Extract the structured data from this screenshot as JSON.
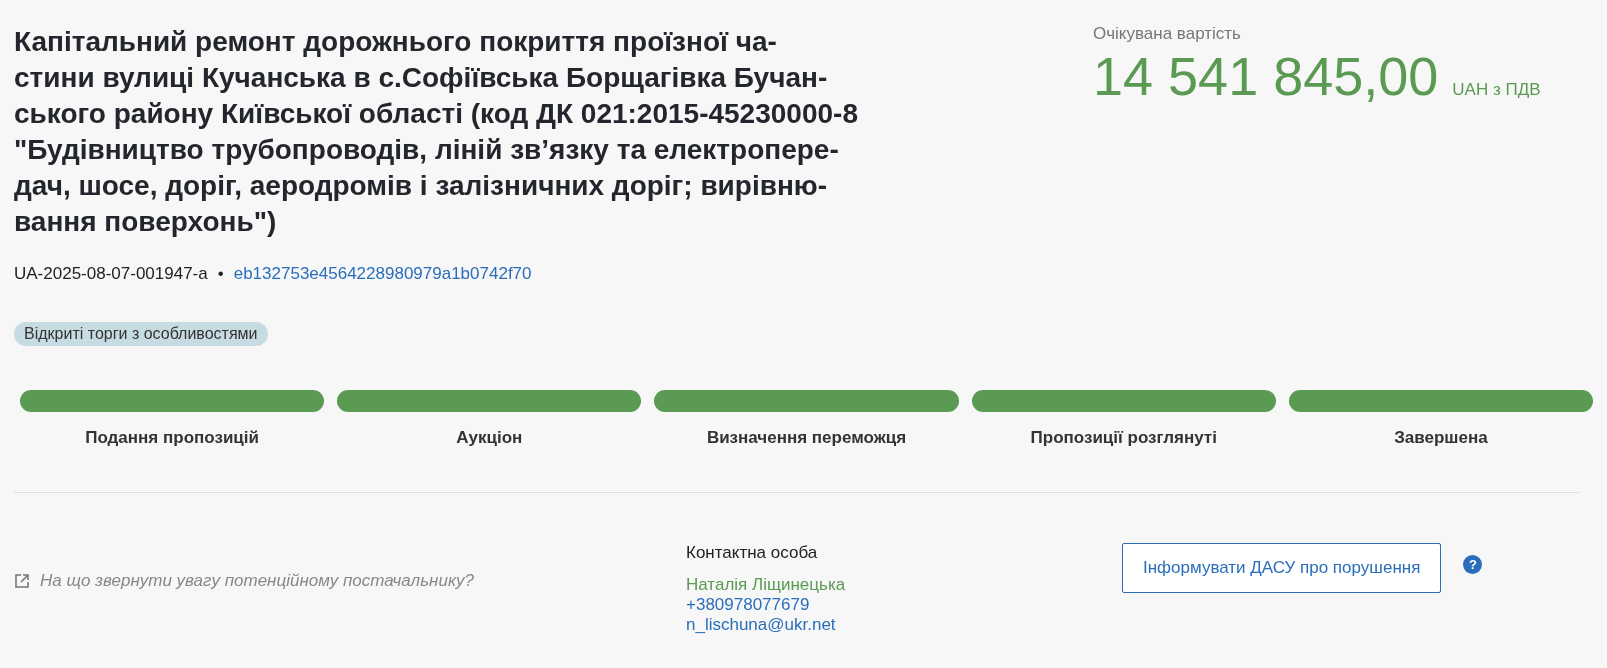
{
  "title_lines": [
    "Капітальний ремонт дорожнього покриття проїзної ча-",
    "стини вулиці Кучанська в с.Софіївська Борщагівка Бучан-",
    "ського району Київської області (код ДК 021:2015-45230000-8",
    "\"Будівництво трубопроводів, ліній зв’язку та електропере-",
    "дач, шосе, доріг, аеродромів і залізничних доріг; вирівню-",
    "вання поверхонь\")"
  ],
  "tender_id": "UA-2025-08-07-001947-a",
  "separator": "•",
  "hash_link": "eb132753e4564228980979a1b0742f70",
  "procedure_tag": "Відкриті торги з особливостями",
  "price": {
    "label": "Очікувана вартість",
    "amount": "14 541 845,00",
    "currency": "UAH з ПДВ"
  },
  "stages": [
    {
      "label": "Подання пропозицій",
      "done": true
    },
    {
      "label": "Аукціон",
      "done": true
    },
    {
      "label": "Визначення переможця",
      "done": true
    },
    {
      "label": "Пропозиції розглянуті",
      "done": true
    },
    {
      "label": "Завершена",
      "done": true
    }
  ],
  "advice_link": "На що звернути увагу потенційному постачальнику?",
  "contact": {
    "heading": "Контактна особа",
    "name": "Наталія Ліщинецька",
    "phone": "+380978077679",
    "email": "n_lischuna@ukr.net"
  },
  "report_button": "Інформувати ДАСУ про порушення",
  "help": "?"
}
